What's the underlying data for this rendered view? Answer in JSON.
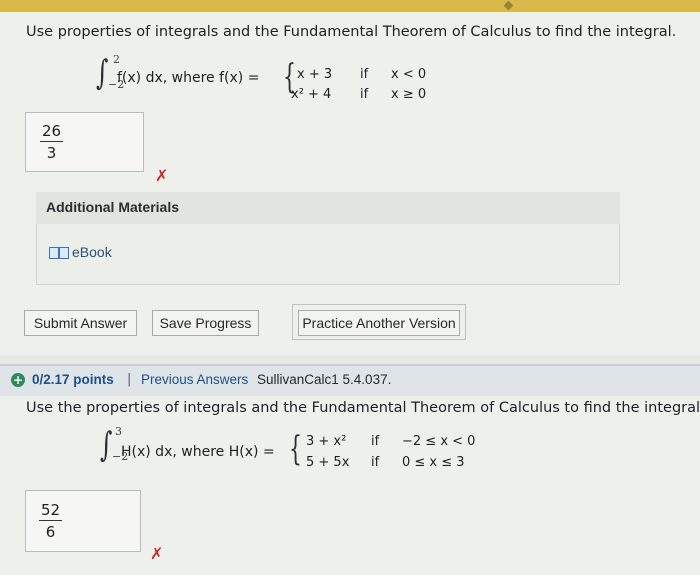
{
  "q1": {
    "prompt": "Use properties of integrals and the Fundamental Theorem of Calculus to find the integral.",
    "upper": "2",
    "lower": "−2",
    "expr": "f(x) dx, where f(x) =",
    "cases": [
      {
        "expr": "x + 3",
        "cond": "if",
        "range": "x < 0"
      },
      {
        "expr": "x² + 4",
        "cond": "if",
        "range": "x ≥ 0"
      }
    ],
    "answer_num": "26",
    "answer_den": "3",
    "result": "✗",
    "additional_materials": "Additional Materials",
    "ebook": "eBook",
    "buttons": {
      "submit": "Submit Answer",
      "save": "Save Progress",
      "practice": "Practice Another Version"
    }
  },
  "q2": {
    "score": "0/2.17 points",
    "separator": "|",
    "previous": "Previous Answers",
    "course": "SullivanCalc1 5.4.037.",
    "prompt": "Use the properties of integrals and the Fundamental Theorem of Calculus to find the integral.",
    "upper": "3",
    "lower": "−2",
    "expr": "H(x) dx, where H(x) =",
    "cases": [
      {
        "expr": "3 + x²",
        "cond": "if",
        "range": "−2 ≤ x < 0"
      },
      {
        "expr": "5 + 5x",
        "cond": "if",
        "range": "0 ≤ x ≤ 3"
      }
    ],
    "answer_num": "52",
    "answer_den": "6",
    "result": "✗"
  },
  "colors": {
    "top_bar": "#d7b94c",
    "link": "#1f4f86",
    "wrong": "#c92a2a",
    "status_icon": "#2d8a5a"
  }
}
